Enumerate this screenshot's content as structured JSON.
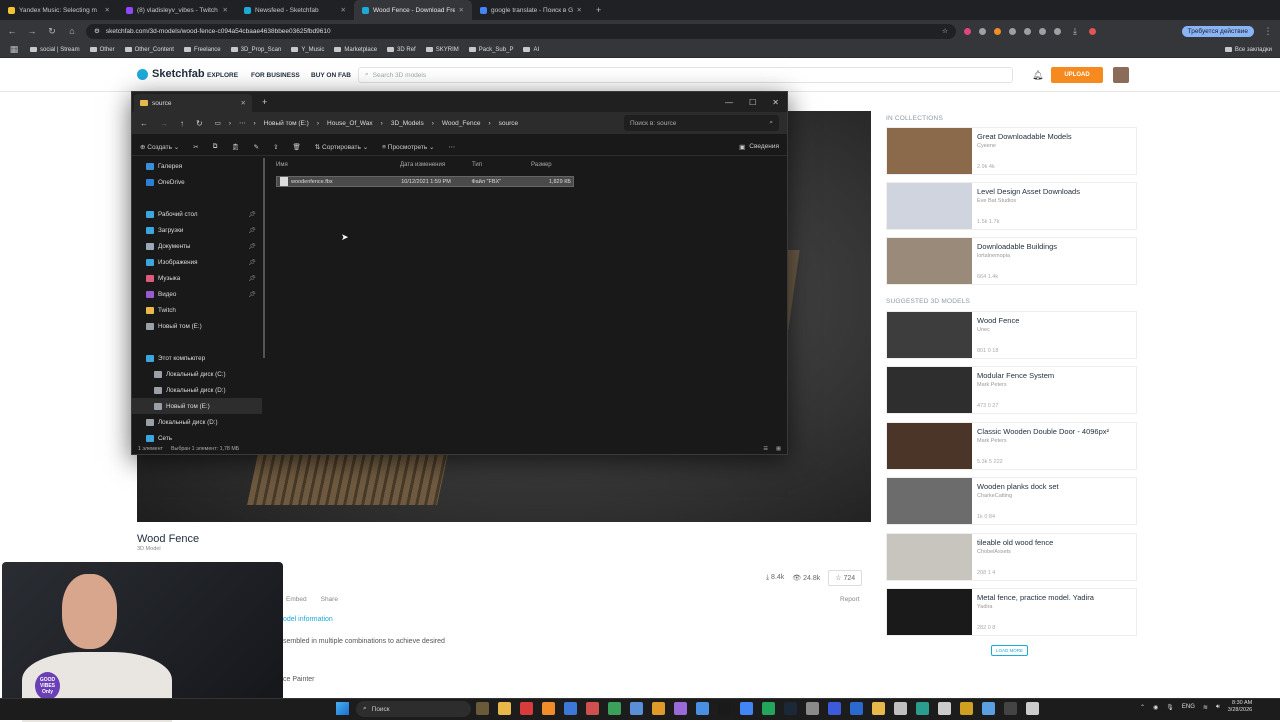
{
  "browser": {
    "tabs": [
      {
        "label": "Yandex Music: Selecting m",
        "color": "#f4c430",
        "active": false
      },
      {
        "label": "(8) vladisleyv_vibes - Twitch",
        "color": "#9146ff",
        "active": false
      },
      {
        "label": "Newsfeed - Sketchfab",
        "color": "#1caad9",
        "active": false
      },
      {
        "label": "Wood Fence - Download Free",
        "color": "#1caad9",
        "active": true
      },
      {
        "label": "google translate - Поиск в Goo",
        "color": "#4285f4",
        "active": false
      }
    ],
    "url": "sketchfab.com/3d-models/wood-fence-c094a54cbaae4638bbee03625fbd9610",
    "update_label": "Требуется действие",
    "bookmarks": [
      "social | Stream",
      "Other",
      "Other_Content",
      "Freelance",
      "3D_Prop_Scan",
      "Y_Music",
      "Marketplace",
      "3D Ref",
      "SKYRIM",
      "Pack_Sub_P",
      "AI"
    ],
    "all_bookmarks": "Все закладки"
  },
  "sketchfab": {
    "logo": "Sketchfab",
    "nav": {
      "explore": "EXPLORE",
      "business": "FOR BUSINESS",
      "buy": "BUY ON FAB"
    },
    "search_placeholder": "Search 3D models",
    "upload": "UPLOAD",
    "model": {
      "title": "Wood Fence",
      "subtitle": "3D Model",
      "downloads": "8.4k",
      "views": "24.8k",
      "likes": "724",
      "embed": "Embed",
      "share": "Share",
      "report": "Report",
      "info_link": "odel information",
      "description": "sembled in multiple combinations to achieve desired",
      "painter": "ce Painter"
    },
    "in_collections_head": "IN COLLECTIONS",
    "collections": [
      {
        "title": "Great Downloadable Models",
        "author": "Cyeene",
        "stats": "2.9k  4k",
        "color": "#8a6a4a"
      },
      {
        "title": "Level Design Asset Downloads",
        "author": "Eve Bat Studios",
        "stats": "1.5k  1.7k",
        "color": "#cfd4de"
      },
      {
        "title": "Downloadable Buildings",
        "author": "lortalnemopia",
        "stats": "664  1.4k",
        "color": "#9a8a7a"
      }
    ],
    "suggested_head": "SUGGESTED 3D MODELS",
    "suggested": [
      {
        "title": "Wood Fence",
        "author": "Unec",
        "stats": "801  0  18",
        "color": "#3d3d3d"
      },
      {
        "title": "Modular Fence System",
        "author": "Mark Peters",
        "stats": "473  0  27",
        "color": "#2e2e2e"
      },
      {
        "title": "Classic Wooden Double Door - 4096px²",
        "author": "Mark Peters",
        "stats": "5.3k  5  222",
        "color": "#4a3528"
      },
      {
        "title": "Wooden planks dock set",
        "author": "CharkeCatting",
        "stats": "1k  0  84",
        "color": "#6c6c6c"
      },
      {
        "title": "tileable old wood fence",
        "author": "ChobelAssets",
        "stats": "208  1  4",
        "color": "#c8c4be"
      },
      {
        "title": "Metal fence, practice model. Yadira",
        "author": "Yadira",
        "stats": "282  0  8",
        "color": "#1a1a1a"
      }
    ],
    "load_more": "LOAD MORE"
  },
  "explorer": {
    "tab_title": "source",
    "path": [
      "Новый том (E:)",
      "House_Of_Wax",
      "3D_Models",
      "Wood_Fence",
      "source"
    ],
    "search_placeholder": "Поиск в: source",
    "cmd": {
      "create": "Создать",
      "sort": "Сортировать",
      "view": "Просмотреть",
      "details": "Сведения"
    },
    "nav_items": [
      {
        "label": "Галерея",
        "color": "#3a8fd8",
        "pin": false,
        "indent": 14
      },
      {
        "label": "OneDrive",
        "color": "#2b7fd4",
        "pin": false,
        "indent": 14
      },
      {
        "label": "",
        "color": "transparent",
        "pin": false,
        "indent": 14
      },
      {
        "label": "Рабочий стол",
        "color": "#3ba5e0",
        "pin": true,
        "indent": 14
      },
      {
        "label": "Загрузки",
        "color": "#3ba5e0",
        "pin": true,
        "indent": 14
      },
      {
        "label": "Документы",
        "color": "#9aa9b8",
        "pin": true,
        "indent": 14
      },
      {
        "label": "Изображения",
        "color": "#3ba5e0",
        "pin": true,
        "indent": 14
      },
      {
        "label": "Музыка",
        "color": "#e05a7a",
        "pin": true,
        "indent": 14
      },
      {
        "label": "Видео",
        "color": "#9b59d0",
        "pin": true,
        "indent": 14
      },
      {
        "label": "Twitch",
        "color": "#e8b84a",
        "pin": false,
        "indent": 14
      },
      {
        "label": "Новый том (E:)",
        "color": "#9aa0a6",
        "pin": false,
        "indent": 14
      },
      {
        "label": "",
        "color": "transparent",
        "pin": false,
        "indent": 14
      },
      {
        "label": "Этот компьютер",
        "color": "#3ba5e0",
        "pin": false,
        "indent": 14
      },
      {
        "label": "Локальный диск (C:)",
        "color": "#9aa0a6",
        "pin": false,
        "indent": 22
      },
      {
        "label": "Локальный диск (D:)",
        "color": "#9aa0a6",
        "pin": false,
        "indent": 22
      },
      {
        "label": "Новый том (E:)",
        "color": "#9aa0a6",
        "pin": false,
        "indent": 22
      },
      {
        "label": "Локальный диск (D:)",
        "color": "#9aa0a6",
        "pin": false,
        "indent": 14
      },
      {
        "label": "Сеть",
        "color": "#3ba5e0",
        "pin": false,
        "indent": 14
      }
    ],
    "columns": {
      "name": "Имя",
      "date": "Дата изменения",
      "type": "Тип",
      "size": "Размер"
    },
    "file": {
      "name": "woodenfence.fbx",
      "date": "10/12/2021 1:59 PM",
      "type": "Файл \"FBX\"",
      "size": "1,829 КБ"
    },
    "status_count": "1 элемент",
    "status_selected": "Выбран 1 элемент: 1,78 МБ"
  },
  "overlay": {
    "logo_text": "GOOD VIBES Only"
  },
  "taskbar": {
    "search": "Поиск",
    "lang": "ENG",
    "time": "8:30 AM",
    "date": "3/28/2026",
    "icons": [
      "#6b5a3a",
      "#e8b84a",
      "#d83b3b",
      "#f28c28",
      "#3b78d8",
      "#d05050",
      "#3aa05a",
      "#5a8fd8",
      "#e09a2a",
      "#9a6ad8",
      "#4a90e2",
      "#1a1a1a",
      "#4285f4",
      "#23a55a",
      "#1b2838",
      "#8a8a8a",
      "#3b5bdb",
      "#2a6acf",
      "#e8b84a",
      "#c0c0c0",
      "#2a9d8f",
      "#ccc",
      "#d0a020",
      "#5aa0e0",
      "#444",
      "#ccc"
    ]
  }
}
